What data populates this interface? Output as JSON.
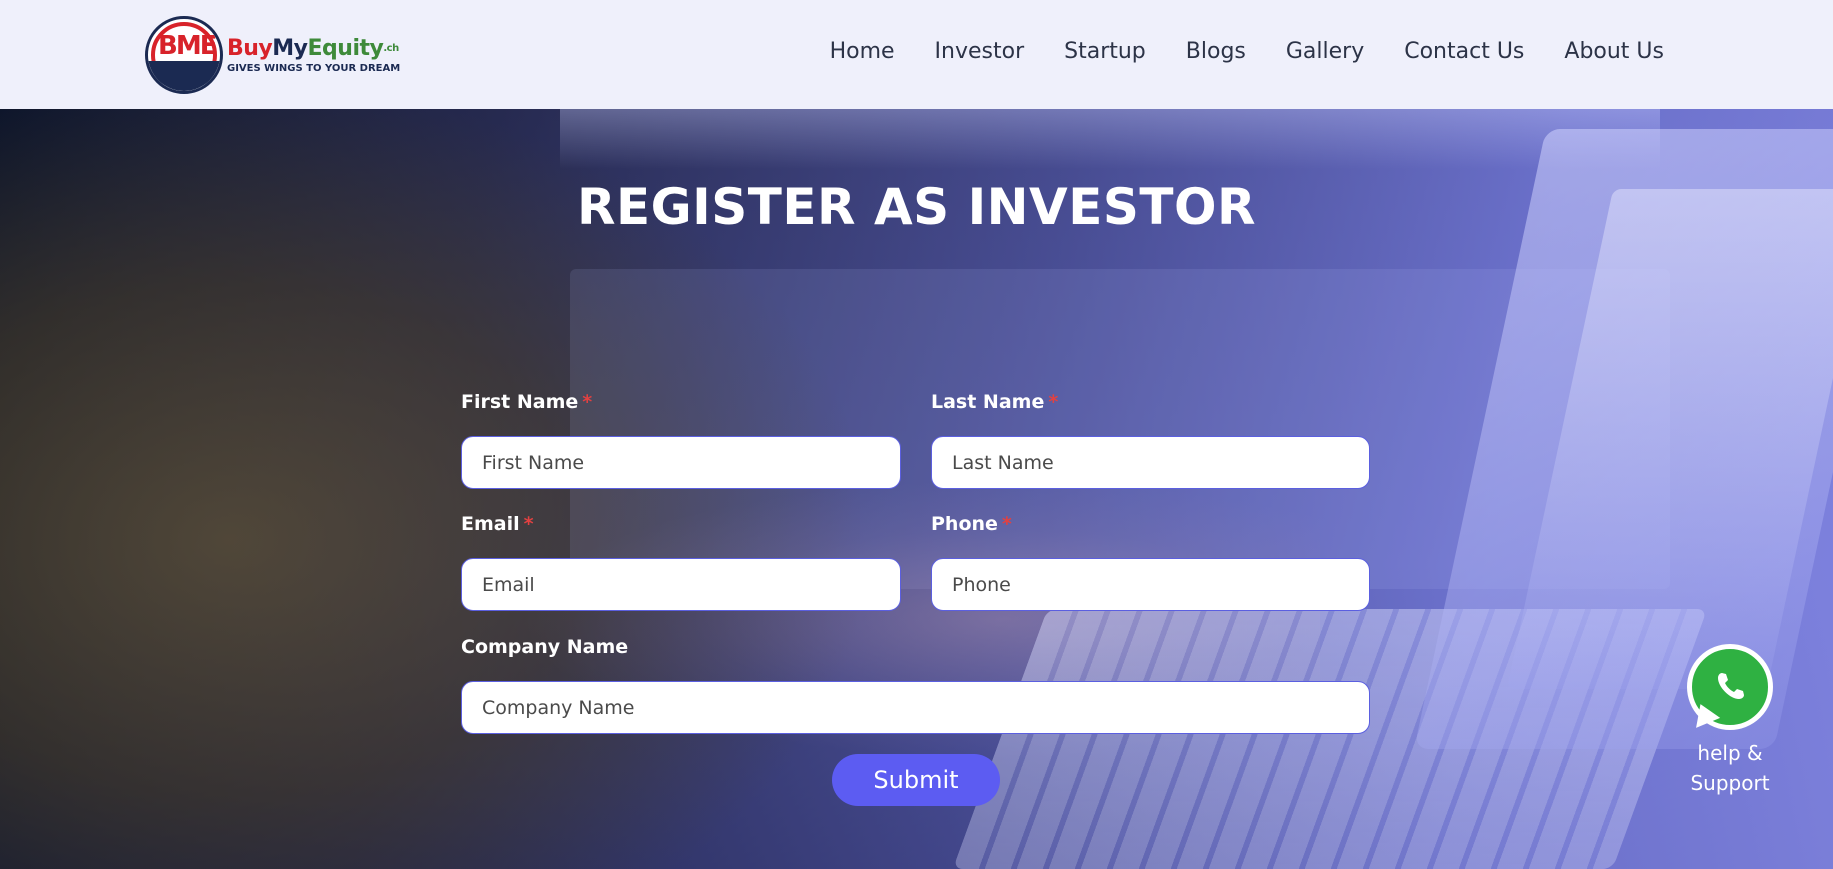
{
  "header": {
    "logo": {
      "mark_letters": "BME",
      "name_part1": "Buy",
      "name_part2": "My",
      "name_part3": "Equity",
      "name_suffix": ".ch",
      "tagline": "GIVES WINGS TO YOUR DREAM"
    },
    "nav": [
      {
        "label": "Home"
      },
      {
        "label": "Investor"
      },
      {
        "label": "Startup"
      },
      {
        "label": "Blogs"
      },
      {
        "label": "Gallery"
      },
      {
        "label": "Contact Us"
      },
      {
        "label": "About Us"
      }
    ]
  },
  "form": {
    "title": "REGISTER AS INVESTOR",
    "required_marker": "*",
    "fields": {
      "first_name": {
        "label": "First Name",
        "placeholder": "First Name",
        "value": ""
      },
      "last_name": {
        "label": "Last Name",
        "placeholder": "Last Name",
        "value": ""
      },
      "email": {
        "label": "Email",
        "placeholder": "Email",
        "value": ""
      },
      "phone": {
        "label": "Phone",
        "placeholder": "Phone",
        "value": ""
      },
      "company_name": {
        "label": "Company Name",
        "placeholder": "Company Name",
        "value": ""
      }
    },
    "submit_label": "Submit"
  },
  "support": {
    "icon": "whatsapp-icon",
    "line1": "help &",
    "line2": "Support"
  },
  "colors": {
    "accent": "#5c5cf2",
    "required": "#e24141",
    "whatsapp": "#2fb142",
    "header_bg": "#eff0fb"
  }
}
